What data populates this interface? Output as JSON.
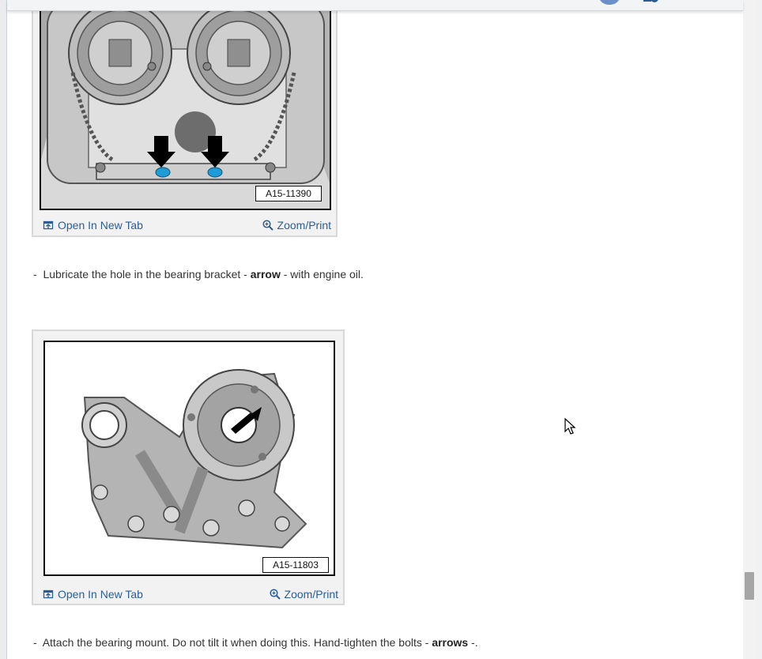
{
  "figures": [
    {
      "id": "A15-11390",
      "open_label": "Open In New Tab",
      "zoom_label": "Zoom/Print"
    },
    {
      "id": "A15-11803",
      "open_label": "Open In New Tab",
      "zoom_label": "Zoom/Print"
    }
  ],
  "steps": [
    {
      "bullet": "-",
      "before": "Lubricate the hole in the bearing bracket - ",
      "bold": "arrow",
      "after": " - with engine oil."
    },
    {
      "bullet": "-",
      "before": "Attach the bearing mount. Do not tilt it when doing this. Hand-tighten the bolts - ",
      "bold": "arrows",
      "after": " -."
    }
  ],
  "colors": {
    "link": "#2a5d95",
    "text": "#333333",
    "accent_avatar": "#6b8fc9"
  },
  "icons": [
    "open-new-tab-icon",
    "zoom-icon",
    "mouse-cursor-icon"
  ]
}
